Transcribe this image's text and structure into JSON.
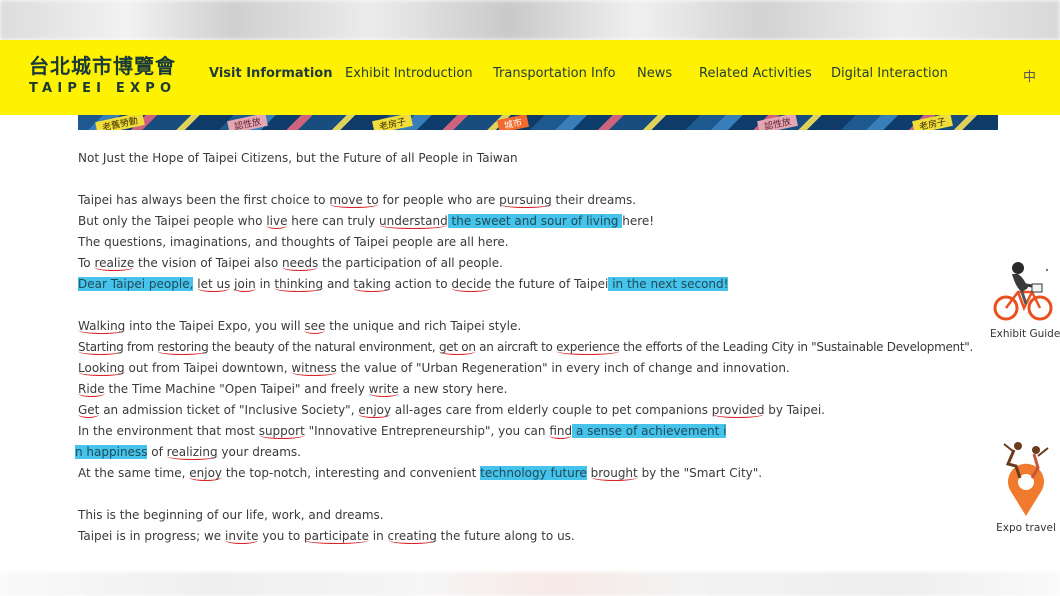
{
  "header": {
    "logo_cn": "台北城市博覽會",
    "logo_en": "TAIPEI EXPO",
    "nav": [
      {
        "label": "Visit Information",
        "active": true
      },
      {
        "label": "Exhibit Introduction",
        "active": false
      },
      {
        "label": "Transportation Info",
        "active": false
      },
      {
        "label": "News",
        "active": false
      },
      {
        "label": "Related Activities",
        "active": false
      },
      {
        "label": "Digital Interaction",
        "active": false
      }
    ],
    "language_toggle": "中",
    "background_color": "#fff200"
  },
  "banner": {
    "tags": [
      "老舊勞動",
      "認性放",
      "老房子",
      "城市",
      "認性放",
      "老房子"
    ]
  },
  "article": {
    "subtitle": "Not Just the Hope of Taipei Citizens, but the Future of all People in Taiwan",
    "p1": {
      "l1": {
        "a": "Taipei has always been the first choice to ",
        "b": "move to",
        "c": " for people who are ",
        "d": "pursuing",
        "e": " their dreams."
      },
      "l2": {
        "a": "But only the Taipei people who ",
        "b": "live",
        "c": " here can truly ",
        "d": "understand",
        "e": " the sweet and sour of living ",
        "f": "here!"
      },
      "l3": "The questions, imaginations, and thoughts of Taipei people are all here.",
      "l4": {
        "a": "To ",
        "b": "realize",
        "c": " the vision of Taipei also ",
        "d": "needs",
        "e": " the participation of all people."
      },
      "l5": {
        "a": "Dear Taipei people,",
        "b": " ",
        "c": "let us",
        "d": " ",
        "e": "join",
        "f": " in ",
        "g": "thinking",
        "h": " and ",
        "i": "taking",
        "j": " action to ",
        "k": "decide",
        "l": " the future of Taipei",
        "m": " in the next second!"
      }
    },
    "p2": {
      "l1": {
        "a": "Walking",
        "b": " into the Taipei Expo, you will ",
        "c": "see",
        "d": " the unique and rich Taipei style."
      },
      "l2": {
        "a": "Starting",
        "b": " from ",
        "c": "restoring",
        "d": " the beauty of the natural environment, ",
        "e": "get on",
        "f": " an aircraft to ",
        "g": "experience",
        "h": " the efforts of the Leading City in \"Sustainable Development\"."
      },
      "l3": {
        "a": "Looking",
        "b": " out from Taipei downtown, ",
        "c": "witness",
        "d": " the value of \"Urban Regeneration\" in every inch of change and innovation."
      },
      "l4": {
        "a": "Ride",
        "b": " the Time Machine \"Open Taipei\" and freely ",
        "c": "write",
        "d": " a new story here."
      },
      "l5": {
        "a": "Get",
        "b": " an admission ticket of \"Inclusive Society\", ",
        "c": "enjoy",
        "d": " all-ages care from elderly couple to pet companions ",
        "e": "provided",
        "f": " by Taipei."
      },
      "l6": {
        "a": "In the environment that most ",
        "b": "support",
        "c": " \"Innovative Entrepreneurship\", you can ",
        "d": "find",
        "e": " a sense of achievement i"
      },
      "l7": {
        "a": "n happiness",
        "b": " of ",
        "c": "realizing",
        "d": " your dreams."
      },
      "l8": {
        "a": "At the same time, ",
        "b": "enjoy",
        "c": " the top-notch, interesting and convenient ",
        "d": "technology future",
        "e": " ",
        "f": "brought",
        "g": " by the \"Smart City\"."
      }
    },
    "p3": {
      "l1": "This is the beginning of our life, work, and dreams.",
      "l2": {
        "a": "Taipei is in progress; we ",
        "b": "invite",
        "c": " you to ",
        "d": "participate",
        "e": " in ",
        "f": "creating",
        "g": " the future along to us."
      }
    }
  },
  "side": {
    "exhibit_guide": "Exhibit Guide",
    "expo_travel": "Expo travel"
  },
  "colors": {
    "highlight": "#45c3ea",
    "underline": "#d8232a",
    "banner": "#0e3b68"
  }
}
